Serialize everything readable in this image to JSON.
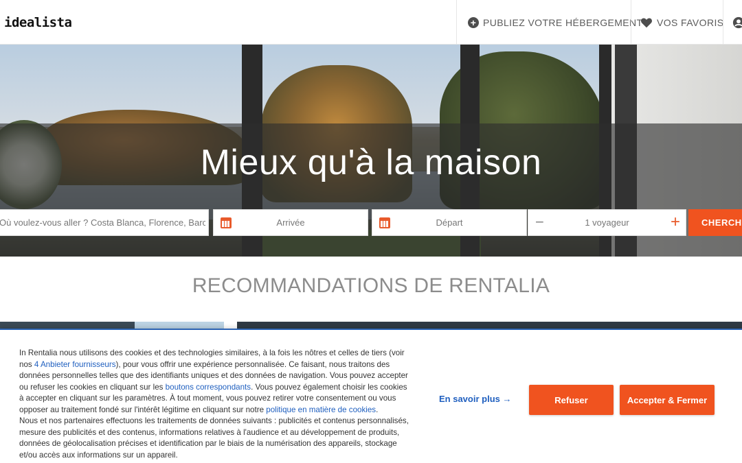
{
  "header": {
    "logo": "idealista",
    "nav": [
      {
        "label": "PUBLIEZ VOTRE HÉBERGEMENT",
        "icon": "plus-circle-icon"
      },
      {
        "label": "VOS FAVORIS",
        "icon": "heart-icon"
      },
      {
        "label": "",
        "icon": "user-icon"
      }
    ]
  },
  "hero": {
    "title": "Mieux qu'à la maison"
  },
  "search": {
    "where_placeholder": "Où voulez-vous aller ? Costa Blanca, Florence, Barc...",
    "arrival_label": "Arrivée",
    "departure_label": "Départ",
    "guests_value": "1 voyageur",
    "minus": "−",
    "plus": "+",
    "button_label": "CHERCHER",
    "accent_color": "#f0531f"
  },
  "recommendations": {
    "title": "RECOMMANDATIONS DE RENTALIA"
  },
  "cookie": {
    "text_1": "In Rentalia nous utilisons des cookies et des technologies similaires, à la fois les nôtres et celles de tiers (voir nos ",
    "link_vendors": "4 Anbieter fournisseurs",
    "text_2": "), pour vous offrir une expérience personnalisée. Ce faisant, nous traitons des données personnelles telles que des identifiants uniques et des données de navigation. Vous pouvez accepter ou refuser les cookies en cliquant sur les ",
    "link_buttons": "boutons correspondants",
    "text_3": ". Vous pouvez également choisir les cookies à accepter en cliquant sur les paramètres. À tout moment, vous pouvez retirer votre consentement ou vous opposer au traitement fondé sur l'intérêt légitime en cliquant sur notre ",
    "link_policy": "politique en matière de cookies",
    "text_4": ".",
    "text_5": "Nous et nos partenaires effectuons les traitements de données suivants : publicités et contenus personnalisés, mesure des publicités et des contenus, informations relatives à l'audience et au développement de produits, données de géolocalisation précises et identification par le biais de la numérisation des appareils, stockage et/ou accès aux informations sur un appareil.",
    "more_link": "En savoir plus →",
    "refuse_label": "Refuser",
    "accept_label": "Accepter & Fermer",
    "link_color": "#1f5fbf"
  }
}
